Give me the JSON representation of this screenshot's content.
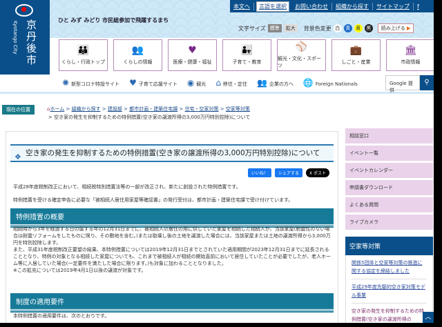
{
  "logo": {
    "name": "京丹後市",
    "name_en": "Kyotango City"
  },
  "tagline": "ひと みず みどり 市民総参加で飛躍するまち",
  "top_links": [
    "本文へ",
    "言語を選択",
    "お問い合わせ",
    "組織から探す",
    "サイトマップ",
    "f"
  ],
  "text_size": {
    "label": "文字サイズ",
    "standard": "標準",
    "large": "拡大"
  },
  "bg_color": {
    "label": "背景色変更",
    "options": [
      "白",
      "青",
      "黄",
      "黒"
    ]
  },
  "read_aloud": "読み上げる",
  "nav": [
    {
      "label": "くらし・行政トップ",
      "icon": "family-icon"
    },
    {
      "label": "くらしの情報",
      "icon": "people-icon"
    },
    {
      "label": "医療・健康・福祉",
      "icon": "heart-hand-icon"
    },
    {
      "label": "子育て・教育",
      "icon": "kids-icon"
    },
    {
      "label": "観光・文化・スポーツ",
      "icon": "bat-icon"
    },
    {
      "label": "しごと・産業",
      "icon": "briefcase-icon"
    },
    {
      "label": "市政情報",
      "icon": "building-icon"
    }
  ],
  "subnav": [
    {
      "label": "新型コロナ特設サイト"
    },
    {
      "label": "子育て応援サイト"
    },
    {
      "label": "観光"
    },
    {
      "label": "移住・定住"
    },
    {
      "label": "企業の方へ"
    },
    {
      "label": "Foreign Nationals"
    }
  ],
  "search": {
    "placeholder": "Google 提供"
  },
  "breadcrumb": {
    "here": "現在の位置",
    "items": [
      "ホーム",
      "組織から探す",
      "建設部",
      "都市計画・建築住宅課",
      "住宅・空家対策",
      "空家等対策"
    ],
    "current": "空き家の発生を抑制するための特例措置(空き家の譲渡所得の3,000万円特別控除)について"
  },
  "page_title": "空き家の発生を抑制するための特例措置(空き家の譲渡所得の3,000万円特別控除)について",
  "share": {
    "like": "いいね！",
    "fb": "シェアする",
    "x": "X ポスト"
  },
  "intro": [
    "平成28年度税制改正において、相続税特別措置法等の一部が改正され、新たに創設された特例措置です。",
    "特例措置を受ける確定申告に必要な「被相続人居住用家屋等確認書」の発行受付は、都市計画・建築住宅課で受け付けています。"
  ],
  "section1": {
    "title": "特例措置の概要",
    "body": [
      "相続時から3年を経過する日の属する年の12月31日までに、被相続人の居住の用に供していた家屋を相続した相続人が、当該家屋(耐震性のない場合は耐震リフォームをしたものに限り、その敷地を含む。)または取壊し後の土地を譲渡した場合には、当該家屋または土地の譲渡所得から3,000万円を特別控除します。",
      "また、平成31年度税制改正要望の結果、本特例措置については2019年12月31日までとされていた適用期間が2023年12月31日までに延長されることとなり、特例の対象となる相続した家屋についても、これまで被相続人が相続の開始直前において居住していたことが必要でしたが、老人ホーム等に入居していた場合(一定要件を満たした場合に限ります。)も対象に加わることとなりました。",
      "※この拡充については2019年4月1日以後の譲渡が対象です。"
    ]
  },
  "section2": {
    "title": "制度の適用要件",
    "body": "本特例措置の適用要件は、次のとおりです。"
  },
  "sidebar": {
    "items": [
      "相談窓口",
      "イベント一覧",
      "イベントカレンダー",
      "申請書ダウンロード",
      "よくある質問",
      "ライブカメラ"
    ],
    "heading": "空家等対策",
    "links": [
      "関係5団体と空家等対策の推進に関する協定を締結しました",
      "平成29年度先駆的空き家対策モデル事業",
      "空き家の発生を抑制するための特例措置(空き家の譲渡所得の"
    ]
  },
  "colors": {
    "primary": "#0a4f8a",
    "section": "#177a99",
    "side": "#e9d2ea"
  }
}
